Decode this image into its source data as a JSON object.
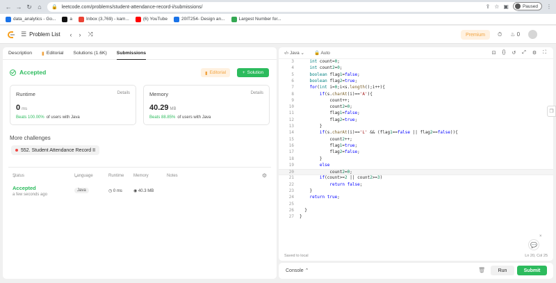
{
  "browser": {
    "url": "leetcode.com/problems/student-attendance-record-i/submissions/",
    "profile_label": "Paused",
    "bookmarks": [
      {
        "label": "data_analytics - Go...",
        "color": "#1a73e8"
      },
      {
        "label": "a",
        "color": "#111111"
      },
      {
        "label": "Inbox (3,769) - kam...",
        "color": "#ea4335"
      },
      {
        "label": "(6) YouTube",
        "color": "#ff0000"
      },
      {
        "label": "20IT254- Design an...",
        "color": "#1a73e8"
      },
      {
        "label": "Largest Number for...",
        "color": "#34a853"
      }
    ]
  },
  "header": {
    "problem_list": "Problem List",
    "premium": "Premium",
    "coins": "0"
  },
  "left": {
    "tabs": [
      {
        "label": "Description"
      },
      {
        "label": "Editorial"
      },
      {
        "label": "Solutions (1.6K)"
      },
      {
        "label": "Submissions"
      }
    ],
    "status": "Accepted",
    "editorial_btn": "Editorial",
    "solution_btn": "Solution",
    "runtime": {
      "label": "Runtime",
      "details": "Details",
      "value": "0",
      "unit": "ms",
      "beats_pct": "Beats 100.00%",
      "beats_txt": "of users with Java"
    },
    "memory": {
      "label": "Memory",
      "details": "Details",
      "value": "40.29",
      "unit": "MB",
      "beats_pct": "Beats 88.85%",
      "beats_txt": "of users with Java"
    },
    "more_challenges": "More challenges",
    "challenge": "552. Student Attendance Record II",
    "table": {
      "headers": {
        "status": "Status",
        "language": "Language",
        "runtime": "Runtime",
        "memory": "Memory",
        "notes": "Notes"
      },
      "row": {
        "status": "Accepted",
        "time": "a few seconds ago",
        "language": "Java",
        "runtime": "0 ms",
        "memory": "40.3 MB"
      }
    }
  },
  "editor": {
    "language": "Java",
    "auto": "Auto",
    "saved": "Saved to local",
    "position": "Ln 20, Col 25",
    "lines": [
      {
        "n": "3",
        "code": "    int count=0;"
      },
      {
        "n": "4",
        "code": "    int count2=0;"
      },
      {
        "n": "5",
        "code": "    boolean flag1=false;"
      },
      {
        "n": "6",
        "code": "    boolean flag2=true;"
      },
      {
        "n": "7",
        "code": "    for(int i=0;i<s.length();i++){"
      },
      {
        "n": "8",
        "code": "        if(s.charAt(i)=='A'){"
      },
      {
        "n": "9",
        "code": "            count++;"
      },
      {
        "n": "10",
        "code": "            count2=0;"
      },
      {
        "n": "11",
        "code": "            flag1=false;"
      },
      {
        "n": "12",
        "code": "            flag2=true;"
      },
      {
        "n": "13",
        "code": "        }"
      },
      {
        "n": "14",
        "code": "        if(s.charAt(i)=='L' && (flag1==false || flag2==false)){"
      },
      {
        "n": "15",
        "code": "            count2++;"
      },
      {
        "n": "16",
        "code": "            flag1=true;"
      },
      {
        "n": "17",
        "code": "            flag2=false;"
      },
      {
        "n": "18",
        "code": "        }"
      },
      {
        "n": "19",
        "code": "        else"
      },
      {
        "n": "20",
        "code": "            count2=0;"
      },
      {
        "n": "21",
        "code": "        if(count>=2 || count2>=3)"
      },
      {
        "n": "22",
        "code": "            return false;"
      },
      {
        "n": "23",
        "code": "    }"
      },
      {
        "n": "24",
        "code": "    return true;"
      },
      {
        "n": "25",
        "code": ""
      },
      {
        "n": "26",
        "code": "  }"
      },
      {
        "n": "27",
        "code": "}"
      }
    ]
  },
  "bottom": {
    "console": "Console",
    "run": "Run",
    "submit": "Submit"
  }
}
